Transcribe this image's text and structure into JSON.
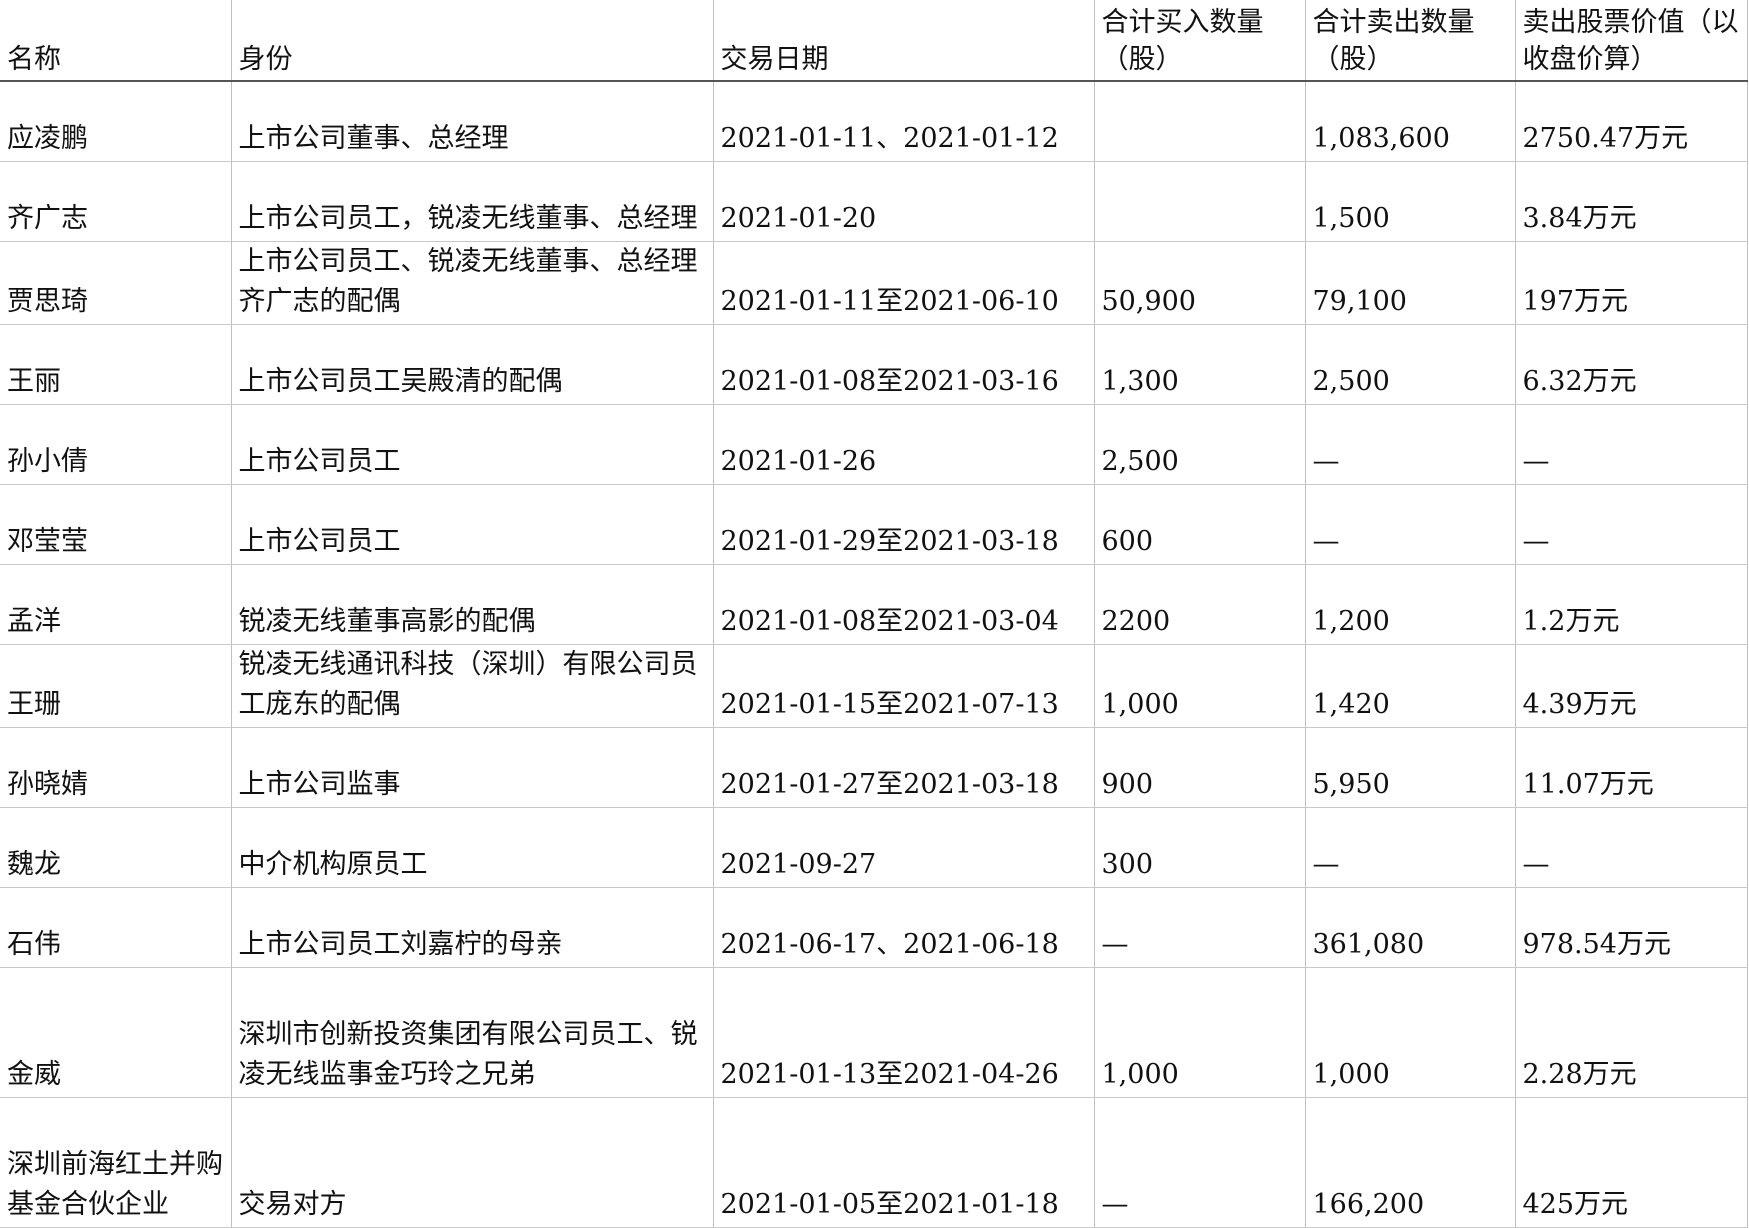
{
  "table": {
    "headers": [
      "名称",
      "身份",
      "交易日期",
      "合计买入数量（股）",
      "合计卖出数量（股）",
      "卖出股票价值（以收盘价算）"
    ],
    "rows": [
      [
        "应凌鹏",
        "上市公司董事、总经理",
        "2021-01-11、2021-01-12",
        "",
        "1,083,600",
        "2750.47万元"
      ],
      [
        "齐广志",
        "上市公司员工，锐凌无线董事、总经理",
        "2021-01-20",
        "",
        "1,500",
        "3.84万元"
      ],
      [
        "贾思琦",
        "上市公司员工、锐凌无线董事、总经理齐广志的配偶",
        "2021-01-11至2021-06-10",
        "50,900",
        "79,100",
        "197万元"
      ],
      [
        "王丽",
        "上市公司员工吴殿清的配偶",
        "2021-01-08至2021-03-16",
        "1,300",
        "2,500",
        "6.32万元"
      ],
      [
        "孙小倩",
        "上市公司员工",
        "2021-01-26",
        "2,500",
        "—",
        "—"
      ],
      [
        "邓莹莹",
        "上市公司员工",
        "2021-01-29至2021-03-18",
        "600",
        "—",
        "—"
      ],
      [
        "孟洋",
        "锐凌无线董事高影的配偶",
        "2021-01-08至2021-03-04",
        "2200",
        "1,200",
        "1.2万元"
      ],
      [
        "王珊",
        "锐凌无线通讯科技（深圳）有限公司员工庞东的配偶",
        "2021-01-15至2021-07-13",
        "1,000",
        "1,420",
        "4.39万元"
      ],
      [
        "孙晓婧",
        "上市公司监事",
        "2021-01-27至2021-03-18",
        "900",
        "5,950",
        "11.07万元"
      ],
      [
        "魏龙",
        "中介机构原员工",
        "2021-09-27",
        "300",
        "—",
        "—"
      ],
      [
        "石伟",
        "上市公司员工刘嘉柠的母亲",
        "2021-06-17、2021-06-18",
        "—",
        "361,080",
        "978.54万元"
      ],
      [
        "金威",
        "深圳市创新投资集团有限公司员工、锐凌无线监事金巧玲之兄弟",
        "2021-01-13至2021-04-26",
        "1,000",
        "1,000",
        "2.28万元"
      ],
      [
        "深圳前海红土并购基金合伙企业",
        "交易对方",
        "2021-01-05至2021-01-18",
        "—",
        "166,200",
        "425万元"
      ]
    ]
  }
}
